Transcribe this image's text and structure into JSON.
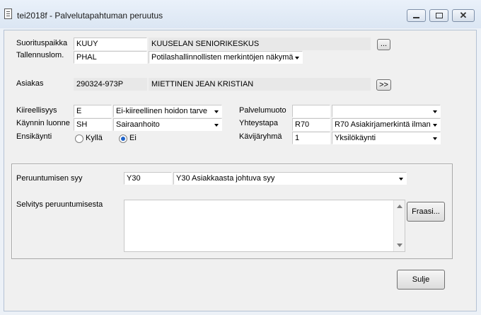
{
  "window": {
    "title": "tei2018f - Palvelutapahtuman peruutus"
  },
  "header": {
    "suorituspaikka_label": "Suorituspaikka",
    "suorituspaikka_code": "KUUY",
    "suorituspaikka_name": "KUUSELAN SENIORIKESKUS",
    "suorituspaikka_button": "...",
    "tallennuslom_label": "Tallennuslom.",
    "tallennuslom_code": "PHAL",
    "tallennuslom_value": "Potilashallinnollisten merkintöjen näkymä",
    "asiakas_label": "Asiakas",
    "asiakas_id": "290324-973P",
    "asiakas_name": "MIETTINEN JEAN KRISTIAN",
    "asiakas_button": ">>"
  },
  "visit": {
    "kiireellisyys_label": "Kiireellisyys",
    "kiireellisyys_code": "E",
    "kiireellisyys_value": "Ei-kiireellinen hoidon tarve",
    "kaynnin_luonne_label": "Käynnin luonne",
    "kaynnin_luonne_code": "SH",
    "kaynnin_luonne_value": "Sairaanhoito",
    "ensikaynti_label": "Ensikäynti",
    "ensikaynti_yes": "Kyllä",
    "ensikaynti_no": "Ei",
    "ensikaynti_selected": "Ei",
    "palvelumuoto_label": "Palvelumuoto",
    "palvelumuoto_code": "",
    "palvelumuoto_value": "",
    "yhteystapa_label": "Yhteystapa",
    "yhteystapa_code": "R70",
    "yhteystapa_value": "R70 Asiakirjamerkintä ilman",
    "kavijaryhma_label": "Kävijäryhmä",
    "kavijaryhma_code": "1",
    "kavijaryhma_value": "Yksilökäynti"
  },
  "cancellation": {
    "syy_label": "Peruuntumisen syy",
    "syy_code": "Y30",
    "syy_value": "Y30 Asiakkaasta johtuva syy",
    "selvitys_label": "Selvitys peruuntumisesta",
    "selvitys_value": "",
    "fraasi_button": "Fraasi..."
  },
  "footer": {
    "close_button": "Sulje"
  }
}
